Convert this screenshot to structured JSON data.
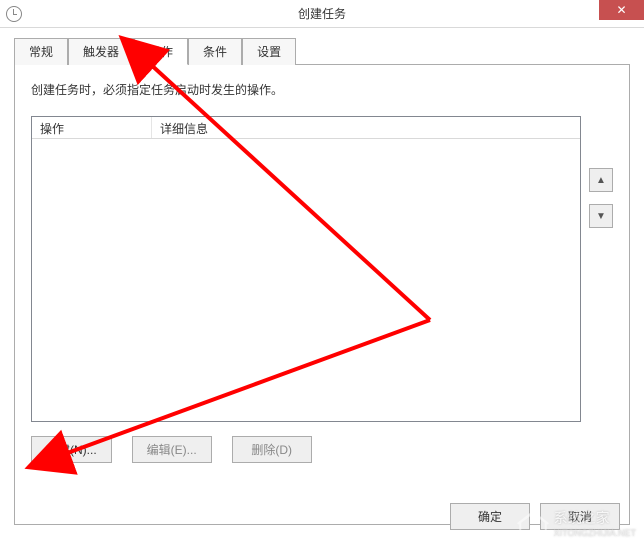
{
  "window": {
    "title": "创建任务",
    "close_label": "✕"
  },
  "tabs": {
    "items": [
      {
        "label": "常规"
      },
      {
        "label": "触发器"
      },
      {
        "label": "操作"
      },
      {
        "label": "条件"
      },
      {
        "label": "设置"
      }
    ],
    "active_index": 2
  },
  "panel": {
    "description": "创建任务时，必须指定任务启动时发生的操作。",
    "columns": {
      "action": "操作",
      "details": "详细信息"
    },
    "move_up": "▲",
    "move_down": "▼",
    "buttons": {
      "new": "新建(N)...",
      "edit": "编辑(E)...",
      "delete": "删除(D)"
    }
  },
  "footer": {
    "ok": "确定",
    "cancel": "取消"
  },
  "watermark": {
    "text": "系统之家",
    "sub": "XITONGZHIJIA.NET"
  }
}
